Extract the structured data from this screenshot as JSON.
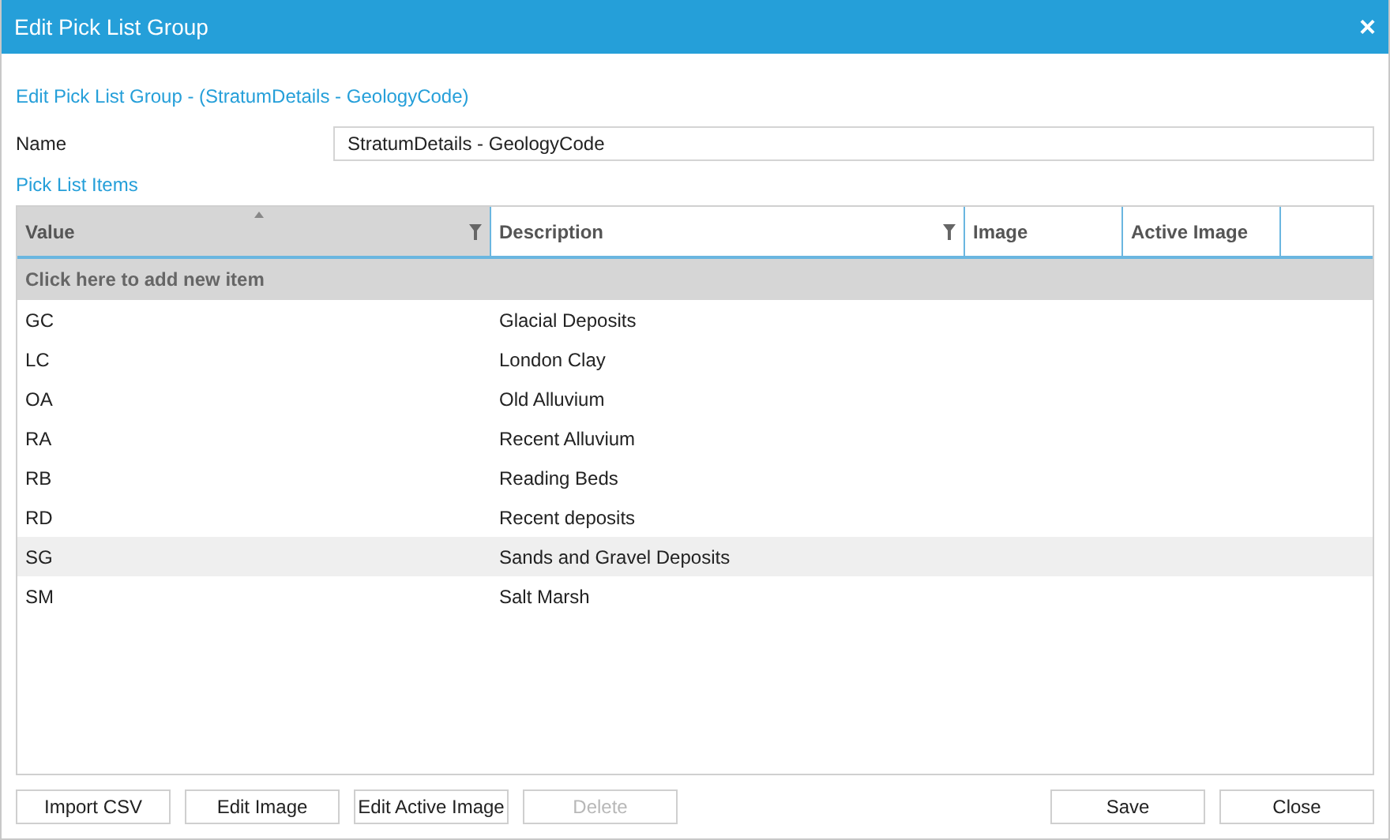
{
  "window": {
    "title": "Edit Pick List Group",
    "close": "×"
  },
  "heading": "Edit Pick List Group - (StratumDetails - GeologyCode)",
  "name_field": {
    "label": "Name",
    "value": "StratumDetails - GeologyCode"
  },
  "section": "Pick List Items",
  "table": {
    "columns": [
      {
        "label": "Value",
        "sorted": true,
        "filter": true
      },
      {
        "label": "Description",
        "sorted": false,
        "filter": true
      },
      {
        "label": "Image",
        "sorted": false,
        "filter": false
      },
      {
        "label": "Active Image",
        "sorted": false,
        "filter": false
      }
    ],
    "new_row": "Click here to add new item",
    "rows": [
      {
        "value": "GC",
        "description": "Glacial Deposits",
        "selected": false
      },
      {
        "value": "LC",
        "description": "London Clay",
        "selected": false
      },
      {
        "value": "OA",
        "description": "Old Alluvium",
        "selected": false
      },
      {
        "value": "RA",
        "description": "Recent Alluvium",
        "selected": false
      },
      {
        "value": "RB",
        "description": "Reading Beds",
        "selected": false
      },
      {
        "value": "RD",
        "description": "Recent deposits",
        "selected": false
      },
      {
        "value": "SG",
        "description": "Sands and Gravel Deposits",
        "selected": true
      },
      {
        "value": "SM",
        "description": "Salt Marsh",
        "selected": false
      }
    ]
  },
  "left_buttons": [
    {
      "label": "Import CSV",
      "disabled": false
    },
    {
      "label": "Edit Image",
      "disabled": false
    },
    {
      "label": "Edit Active Image",
      "disabled": false
    },
    {
      "label": "Delete",
      "disabled": true
    }
  ],
  "right_buttons": [
    {
      "label": "Save",
      "disabled": false
    },
    {
      "label": "Close",
      "disabled": false
    }
  ]
}
